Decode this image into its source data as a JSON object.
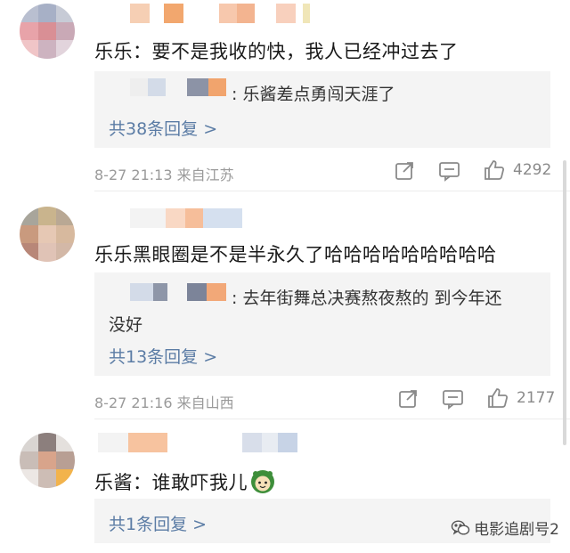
{
  "comments": [
    {
      "text": "乐乐：要不是我收的快，我人已经冲过去了",
      "reply": {
        "text": ": 乐酱差点勇闯天涯了",
        "count_label": "共38条回复 >"
      },
      "meta": "8-27 21:13  来自江苏",
      "likes": "4292"
    },
    {
      "text": "乐乐黑眼圈是不是半永久了哈哈哈哈哈哈哈哈哈",
      "reply": {
        "text_line1": ": 去年街舞总决赛熬夜熬的 到今年还",
        "text_line2": "没好",
        "count_label": "共13条回复 >"
      },
      "meta": "8-27 21:16  来自山西",
      "likes": "2177"
    },
    {
      "text": "乐酱：谁敢吓我儿",
      "reply": {
        "count_label": "共1条回复 >"
      }
    }
  ],
  "watermark": "电影追剧号2",
  "colors": {
    "link": "#5b7ca5",
    "meta": "#9a9a9a",
    "reply_bg": "#f4f4f4"
  },
  "icons": [
    "share-icon",
    "comment-icon",
    "like-icon",
    "emoji-sticker-icon",
    "wechat-logo-icon"
  ]
}
